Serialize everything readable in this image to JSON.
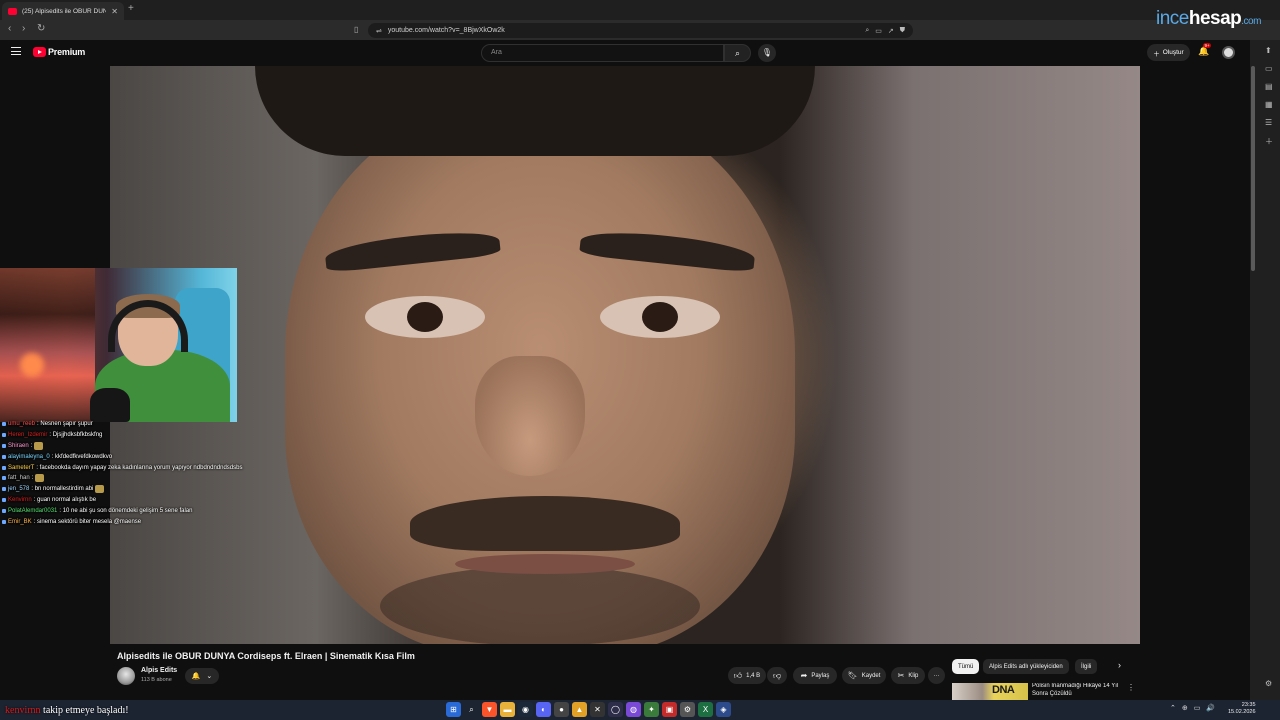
{
  "browser": {
    "tab_title": "(25) Alpisedits ile OBUR DUNYA",
    "url": "youtube.com/watch?v=_8BjwXkOw2k",
    "new_tab": "+",
    "brand": {
      "part1": "ince",
      "part2": "hesap",
      "part3": ".com"
    }
  },
  "youtube": {
    "logo_text": "Premium",
    "search_placeholder": "Ara",
    "create_label": "Oluştur",
    "notifications_badge": "9+"
  },
  "chat": [
    {
      "user": "umu_reeb",
      "user_color": "#ff4d4d",
      "text": ": Nesnen şapır şupur"
    },
    {
      "user": "Heren_Izdemir",
      "user_color": "#d91f1f",
      "text": ": Djsjjhdksbfkbskfng"
    },
    {
      "user": "Shiraen",
      "user_color": "#ff9ad1",
      "text": ":",
      "emote": true
    },
    {
      "user": "alayimaleyna_0",
      "user_color": "#7ad6ff",
      "text": ": kkfdedfkvefdkowdkvo"
    },
    {
      "user": "SameterT",
      "user_color": "#ffd24d",
      "text": ": facebookda dayım yapay zeka kadınlarına yorum yapıyor ndbdndndndsdsbs"
    },
    {
      "user": "fatt_han",
      "user_color": "#c9c9c9",
      "text": ":",
      "emote": true
    },
    {
      "user": "jen_578",
      "user_color": "#9fd4ff",
      "text": ": bn normallestirdim abi",
      "emote": true
    },
    {
      "user": "Kenvirnn",
      "user_color": "#d91f1f",
      "text": ": guan normal alıştık be"
    },
    {
      "user": "PolatAlemdar0031",
      "user_color": "#54e06f",
      "text": ": 10 ne abi şu son dönemdeki gelişim 5 sene falan"
    },
    {
      "user": "Emir_BK",
      "user_color": "#ffb347",
      "text": ": sinema sektörü biter mesela @maense"
    }
  ],
  "video": {
    "title": "Alpisedits ile OBUR DUNYA Cordiseps ft. Elraen | Sinematik Kısa Film",
    "channel": "Alpis Edits",
    "subscribers": "113 B abone",
    "likes": "1,4 B",
    "share_label": "Paylaş",
    "save_label": "Kaydet",
    "clip_label": "Klip",
    "more": "···"
  },
  "chips": [
    "Tümü",
    "Alpis Edits adlı yükleyiciden",
    "İlgili"
  ],
  "recommendation": {
    "thumb_text": "DNA",
    "title": "Polisin İnanmadığı Hikâye 14 Yıl Sonra Çözüldü"
  },
  "alert": {
    "user": "kenvirnn",
    "text": " takip etmeye başladı!"
  },
  "clock": {
    "time": "23:35",
    "date": "15.02.2026"
  },
  "tray": [
    "⌃",
    "⊕",
    "▭",
    "🔊"
  ]
}
